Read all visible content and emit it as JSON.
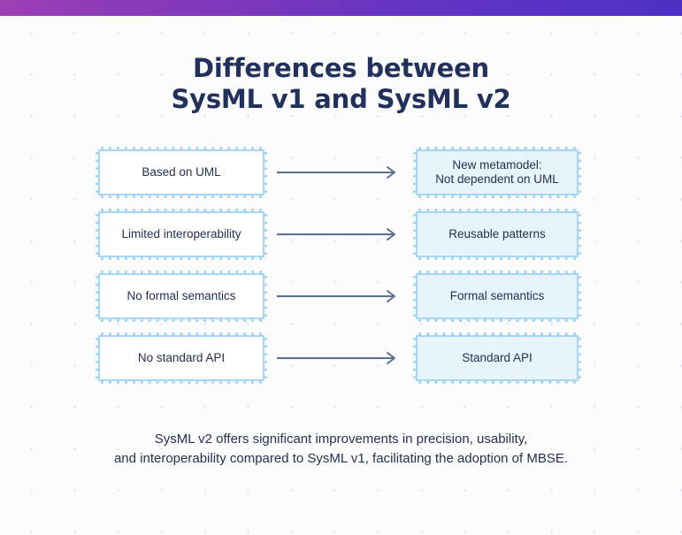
{
  "topbar": {
    "gradient_from": "#a03fb4",
    "gradient_to": "#4e31c6"
  },
  "title": {
    "line1": "Differences between",
    "line2": "SysML v1 and SysML v2",
    "color": "#22305c"
  },
  "colors": {
    "background": "#fcfcfd",
    "dot_grid": "#dfdfe6",
    "box_border": "#a6d6f5",
    "box_left_fill": "#ffffff",
    "box_right_fill": "#e6f4fc",
    "box_text": "#25304f",
    "arrow": "#5b6f92",
    "caption_text": "#26304f"
  },
  "comparison": {
    "rows": [
      {
        "left": "Based on UML",
        "right": "New metamodel:\nNot dependent on UML",
        "right_line1": "New metamodel:",
        "right_line2": "Not dependent on UML",
        "arrow": "arrow-right-icon"
      },
      {
        "left": "Limited interoperability",
        "right": "Reusable patterns",
        "right_line1": "Reusable patterns",
        "right_line2": "",
        "arrow": "arrow-right-icon"
      },
      {
        "left": "No formal semantics",
        "right": "Formal semantics",
        "right_line1": "Formal semantics",
        "right_line2": "",
        "arrow": "arrow-right-icon"
      },
      {
        "left": "No standard API",
        "right": "Standard API",
        "right_line1": "Standard API",
        "right_line2": "",
        "arrow": "arrow-right-icon"
      }
    ]
  },
  "caption": {
    "line1": "SysML v2 offers significant improvements in precision, usability,",
    "line2": "and interoperability compared to SysML v1, facilitating the adoption of MBSE."
  }
}
